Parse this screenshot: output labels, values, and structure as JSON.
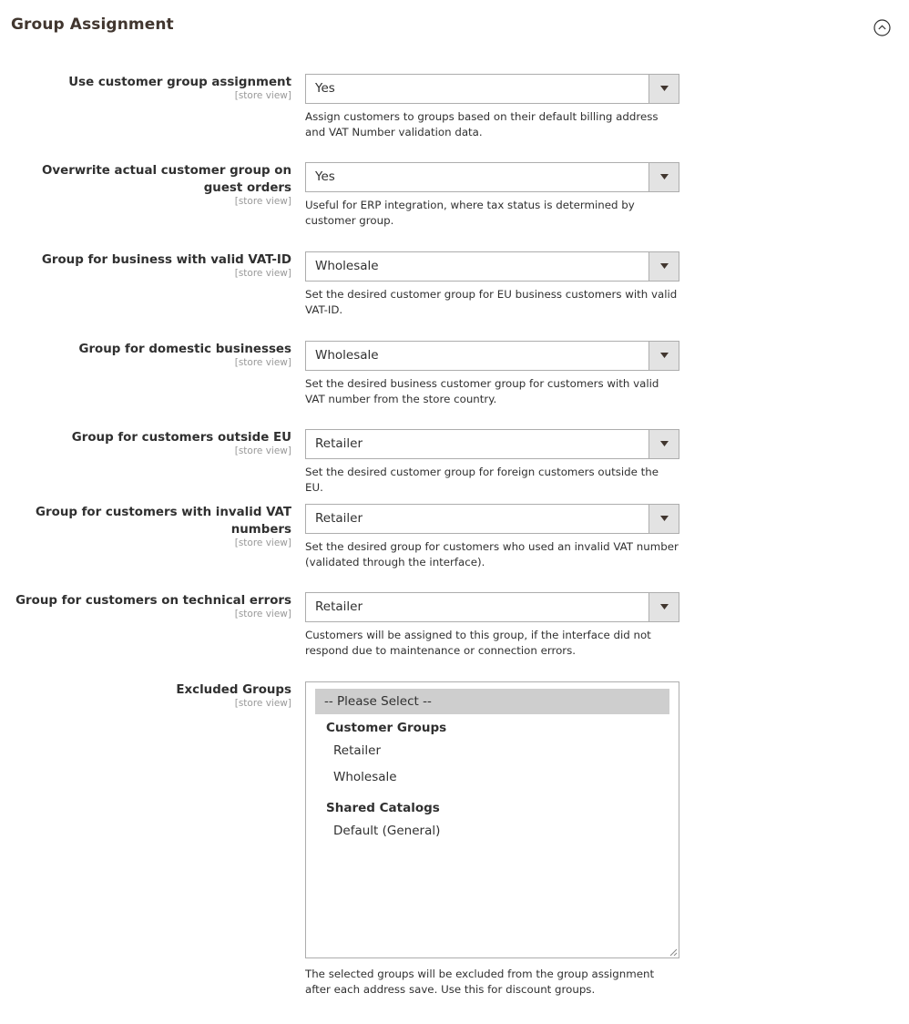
{
  "section": {
    "title": "Group Assignment",
    "collapse_icon": "chevron-up-circle-icon"
  },
  "fields": [
    {
      "label": "Use customer group assignment",
      "scope": "[store view]",
      "value": "Yes",
      "note": "Assign customers to groups based on their default billing address and VAT Number validation data."
    },
    {
      "label": "Overwrite actual customer group on guest orders",
      "scope": "[store view]",
      "value": "Yes",
      "note": "Useful for ERP integration, where tax status is determined by customer group."
    },
    {
      "label": "Group for business with valid VAT-ID",
      "scope": "[store view]",
      "value": "Wholesale",
      "note": "Set the desired customer group for EU business customers with valid VAT-ID."
    },
    {
      "label": "Group for domestic businesses",
      "scope": "[store view]",
      "value": "Wholesale",
      "note": "Set the desired business customer group for customers with valid VAT number from the store country."
    },
    {
      "label": "Group for customers outside EU",
      "scope": "[store view]",
      "value": "Retailer",
      "note": "Set the desired customer group for foreign customers outside the EU."
    },
    {
      "label": "Group for customers with invalid VAT numbers",
      "scope": "[store view]",
      "value": "Retailer",
      "note": "Set the desired group for customers who used an invalid VAT number (validated through the interface)."
    },
    {
      "label": "Group for customers on technical errors",
      "scope": "[store view]",
      "value": "Retailer",
      "note": "Customers will be assigned to this group, if the interface did not respond due to maintenance or connection errors."
    }
  ],
  "excluded_groups": {
    "label": "Excluded Groups",
    "scope": "[store view]",
    "placeholder_option": "-- Please Select --",
    "groups": [
      {
        "label": "Customer Groups",
        "options": [
          "Retailer",
          "Wholesale"
        ]
      },
      {
        "label": "Shared Catalogs",
        "options": [
          "Default (General)"
        ]
      }
    ],
    "note": "The selected groups will be excluded from the group assignment after each address save. Use this for discount groups."
  }
}
